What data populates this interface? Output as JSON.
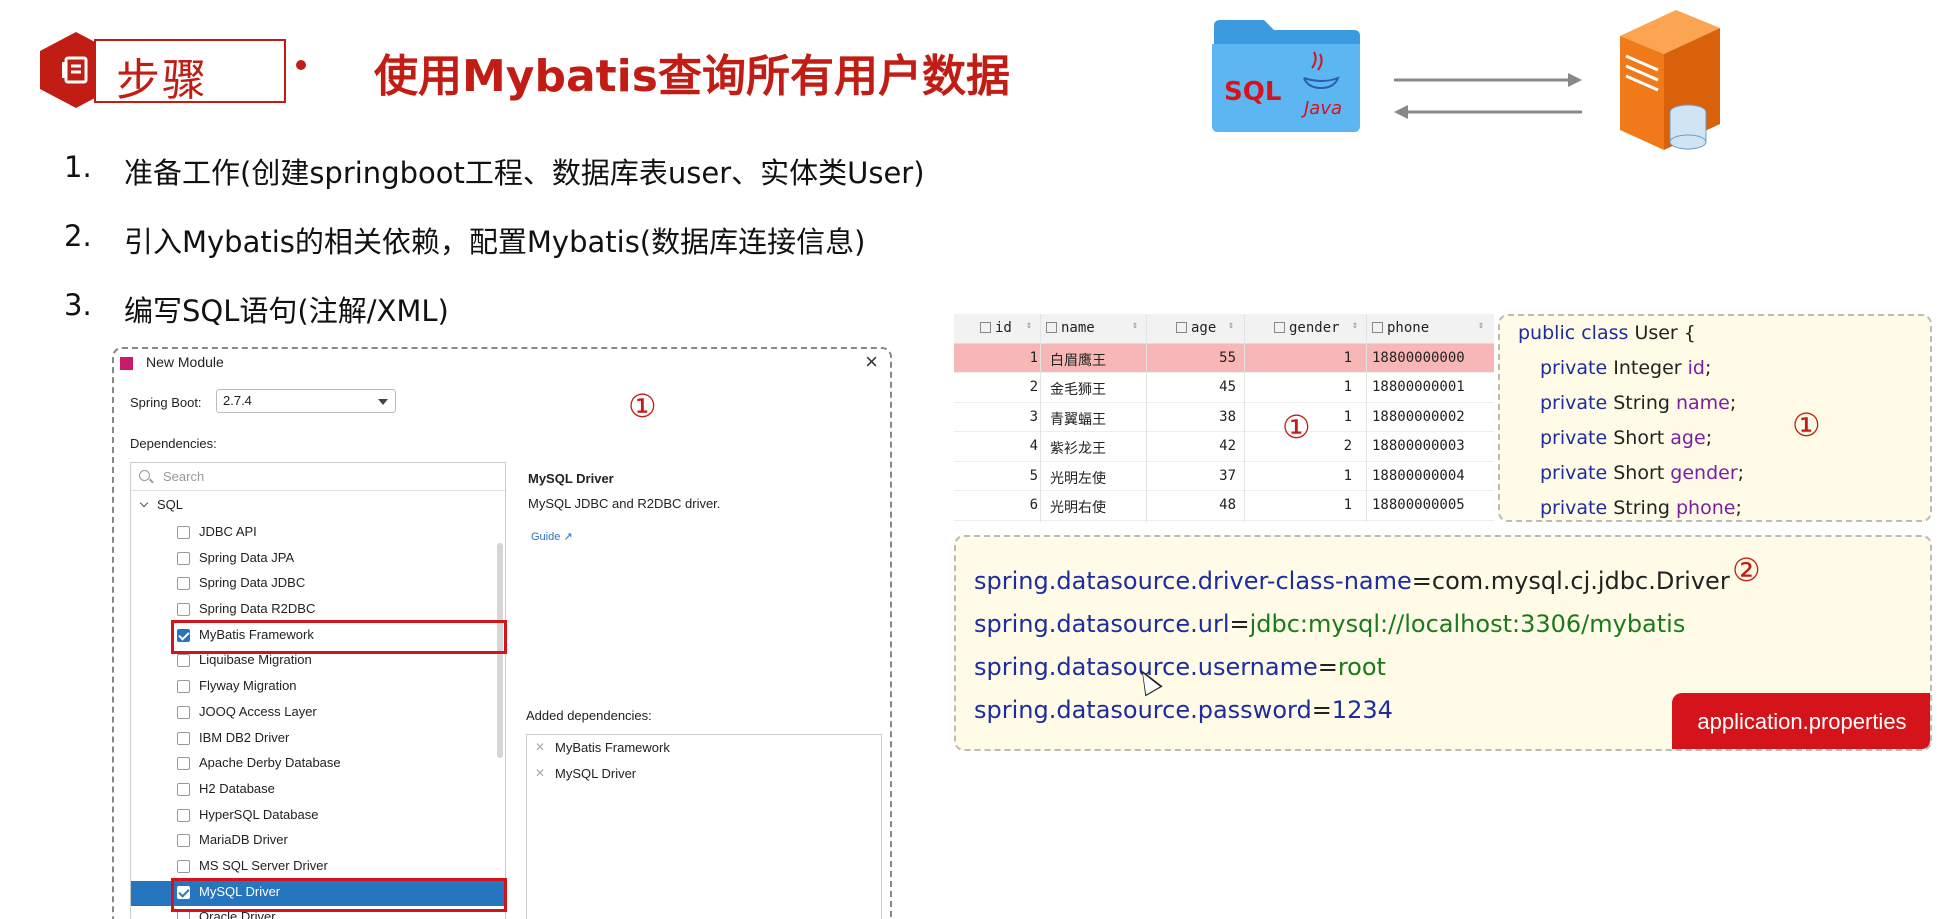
{
  "header": {
    "badge_label": "步骤",
    "badge_icon": "document-icon",
    "title": "使用Mybatis查询所有用户数据",
    "brand_color": "#c21d14"
  },
  "steps": [
    {
      "num": "1.",
      "text": "准备工作(创建springboot工程、数据库表user、实体类User)"
    },
    {
      "num": "2.",
      "text": "引入Mybatis的相关依赖，配置Mybatis(数据库连接信息)"
    },
    {
      "num": "3.",
      "text": "编写SQL语句(注解/XML)"
    }
  ],
  "illustration": {
    "folder_sql": "SQL",
    "folder_java": "Java"
  },
  "dialog": {
    "title": "New Module",
    "spring_boot_label": "Spring Boot:",
    "spring_boot_value": "2.7.4",
    "dependencies_label": "Dependencies:",
    "search_placeholder": "Search",
    "group": "SQL",
    "marker": "①",
    "items": [
      {
        "label": "JDBC API",
        "checked": false
      },
      {
        "label": "Spring Data JPA",
        "checked": false
      },
      {
        "label": "Spring Data JDBC",
        "checked": false
      },
      {
        "label": "Spring Data R2DBC",
        "checked": false
      },
      {
        "label": "MyBatis Framework",
        "checked": true
      },
      {
        "label": "Liquibase Migration",
        "checked": false
      },
      {
        "label": "Flyway Migration",
        "checked": false
      },
      {
        "label": "JOOQ Access Layer",
        "checked": false
      },
      {
        "label": "IBM DB2 Driver",
        "checked": false
      },
      {
        "label": "Apache Derby Database",
        "checked": false
      },
      {
        "label": "H2 Database",
        "checked": false
      },
      {
        "label": "HyperSQL Database",
        "checked": false
      },
      {
        "label": "MariaDB Driver",
        "checked": false
      },
      {
        "label": "MS SQL Server Driver",
        "checked": false
      },
      {
        "label": "MySQL Driver",
        "checked": true
      },
      {
        "label": "Oracle Driver",
        "checked": false
      }
    ],
    "detail_title": "MySQL Driver",
    "detail_desc": "MySQL JDBC and R2DBC driver.",
    "detail_guide": "Guide ↗",
    "added_label": "Added dependencies:",
    "added": [
      "MyBatis Framework",
      "MySQL Driver"
    ]
  },
  "db_table": {
    "columns": [
      "id",
      "name",
      "age",
      "gender",
      "phone"
    ],
    "rows": [
      [
        "1",
        "白眉鹰王",
        "55",
        "1",
        "18800000000"
      ],
      [
        "2",
        "金毛狮王",
        "45",
        "1",
        "18800000001"
      ],
      [
        "3",
        "青翼蝠王",
        "38",
        "1",
        "18800000002"
      ],
      [
        "4",
        "紫衫龙王",
        "42",
        "2",
        "18800000003"
      ],
      [
        "5",
        "光明左使",
        "37",
        "1",
        "18800000004"
      ],
      [
        "6",
        "光明右使",
        "48",
        "1",
        "18800000005"
      ]
    ],
    "marker": "①"
  },
  "class_code": {
    "marker": "①",
    "line0": {
      "kw1": "public",
      "kw2": "class",
      "name": "User {"
    },
    "fields": [
      {
        "kw": "private",
        "type": "Integer",
        "name": "id"
      },
      {
        "kw": "private",
        "type": "String",
        "name": "name"
      },
      {
        "kw": "private",
        "type": "Short",
        "name": "age"
      },
      {
        "kw": "private",
        "type": "Short",
        "name": "gender"
      },
      {
        "kw": "private",
        "type": "String",
        "name": "phone"
      }
    ]
  },
  "properties": {
    "marker": "②",
    "lines": [
      {
        "key": "spring.datasource.driver-class-name",
        "eq": "=",
        "value": "com.mysql.cj.jdbc.Driver"
      },
      {
        "key": "spring.datasource.url",
        "eq": "=",
        "value": "jdbc:mysql://localhost:3306/mybatis"
      },
      {
        "key": "spring.datasource.username",
        "eq": "=",
        "value": "root"
      },
      {
        "key": "spring.datasource.password",
        "eq": "=",
        "value": "1234"
      }
    ],
    "file_tag": "application.properties"
  }
}
